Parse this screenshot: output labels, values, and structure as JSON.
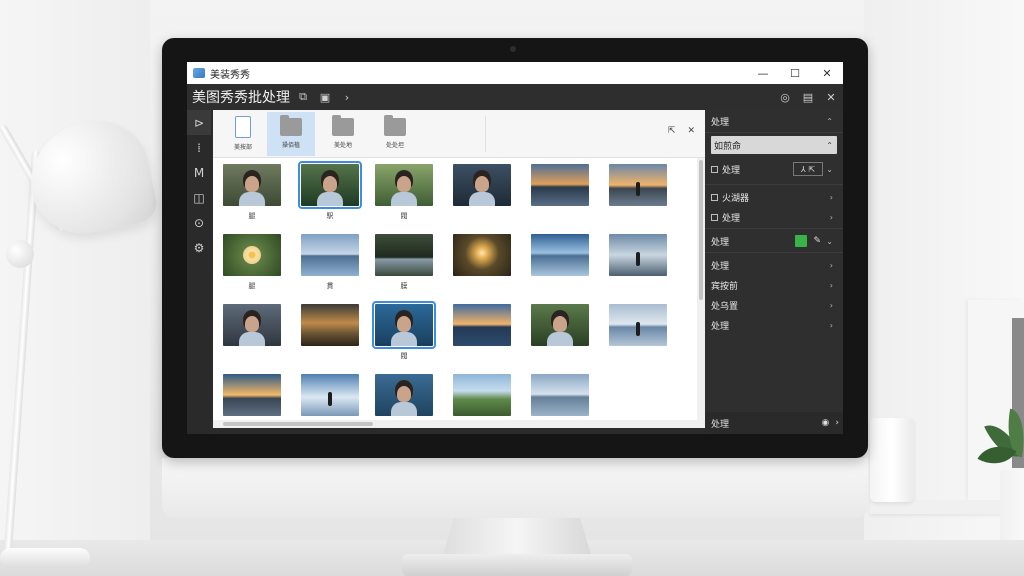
{
  "app": {
    "window_title": "美装秀秀",
    "toolbar_title": "美图秀秀批处理",
    "controls": {
      "minimize": "—",
      "maximize": "☐",
      "close": "✕"
    }
  },
  "toolbar": {
    "buttons": [
      "⧉",
      "▣",
      "›"
    ],
    "right_buttons": [
      "◎",
      "▤",
      "✕"
    ]
  },
  "rail": {
    "icons": [
      "crop-icon",
      "adjust-icon",
      "text-icon",
      "frame-icon",
      "sticker-icon",
      "settings-icon"
    ],
    "glyphs": [
      "⊳",
      "⁞",
      "M",
      "◫",
      "⊙",
      "⚙"
    ]
  },
  "folders": [
    {
      "label": "美按部",
      "type": "document"
    },
    {
      "label": "操佰植",
      "type": "folder",
      "selected": true
    },
    {
      "label": "美处地",
      "type": "folder"
    },
    {
      "label": "处处坦",
      "type": "folder"
    }
  ],
  "folder_tools": [
    "⇱",
    "✕"
  ],
  "thumbnails": [
    {
      "scene": "portrait",
      "label": "腿"
    },
    {
      "scene": "forest-portrait",
      "label": "駅",
      "selected": true
    },
    {
      "scene": "garden-portrait",
      "label": "閥"
    },
    {
      "scene": "portrait-dark",
      "label": ""
    },
    {
      "scene": "sunset-road",
      "label": ""
    },
    {
      "scene": "sunset-person",
      "label": ""
    },
    {
      "scene": "flower",
      "label": "腿"
    },
    {
      "scene": "lake",
      "label": "貫"
    },
    {
      "scene": "forest-road",
      "label": "膜"
    },
    {
      "scene": "sunburst",
      "label": ""
    },
    {
      "scene": "sky-road",
      "label": ""
    },
    {
      "scene": "beach-person",
      "label": ""
    },
    {
      "scene": "portrait-field",
      "label": ""
    },
    {
      "scene": "field-path",
      "label": ""
    },
    {
      "scene": "portrait-blue",
      "label": "閥",
      "selected": true
    },
    {
      "scene": "sunset-pier",
      "label": ""
    },
    {
      "scene": "portrait-green",
      "label": ""
    },
    {
      "scene": "lake-person",
      "label": ""
    },
    {
      "scene": "sunset-road-2",
      "label": ""
    },
    {
      "scene": "sky-person",
      "label": ""
    },
    {
      "scene": "portrait-sea",
      "label": ""
    },
    {
      "scene": "coast-road",
      "label": ""
    },
    {
      "scene": "calm-sea",
      "label": ""
    }
  ],
  "panel": {
    "header": "处理",
    "select_value": "如煎命",
    "rows": [
      {
        "label": "处理",
        "check": true,
        "button": "⅄ ⇱"
      },
      {
        "label": "火湖器",
        "check": true
      },
      {
        "label": "处理",
        "check": true
      },
      {
        "label": "处理",
        "green": true,
        "icon": "✎"
      },
      {
        "label": "处理"
      },
      {
        "label": "宾按前"
      },
      {
        "label": "处乌置"
      },
      {
        "label": "处理"
      }
    ],
    "footer_label": "处理",
    "footer_buttons": [
      "◉",
      "›"
    ]
  }
}
